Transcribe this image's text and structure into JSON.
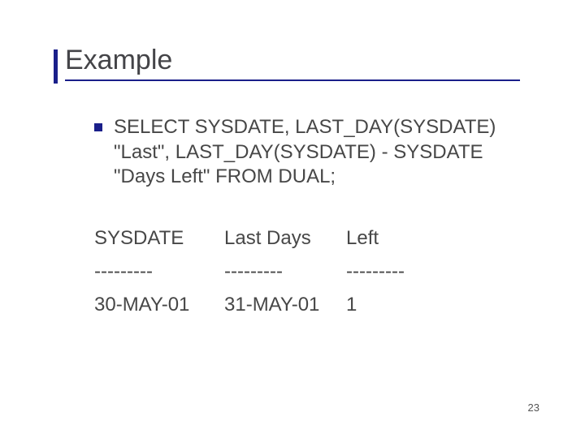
{
  "title": "Example",
  "sql_line1": "SELECT SYSDATE, LAST_DAY(SYSDATE)",
  "sql_line2": "\"Last\", LAST_DAY(SYSDATE) - SYSDATE",
  "sql_line3": "\"Days Left\" FROM DUAL;",
  "result": {
    "header": {
      "c1": "SYSDATE",
      "c2": "Last Days",
      "c3": "Left"
    },
    "sep": {
      "c1": "---------",
      "c2": "---------",
      "c3": "---------"
    },
    "row": {
      "c1": "30-MAY-01",
      "c2": "31-MAY-01",
      "c3": "1"
    }
  },
  "page_number": "23"
}
